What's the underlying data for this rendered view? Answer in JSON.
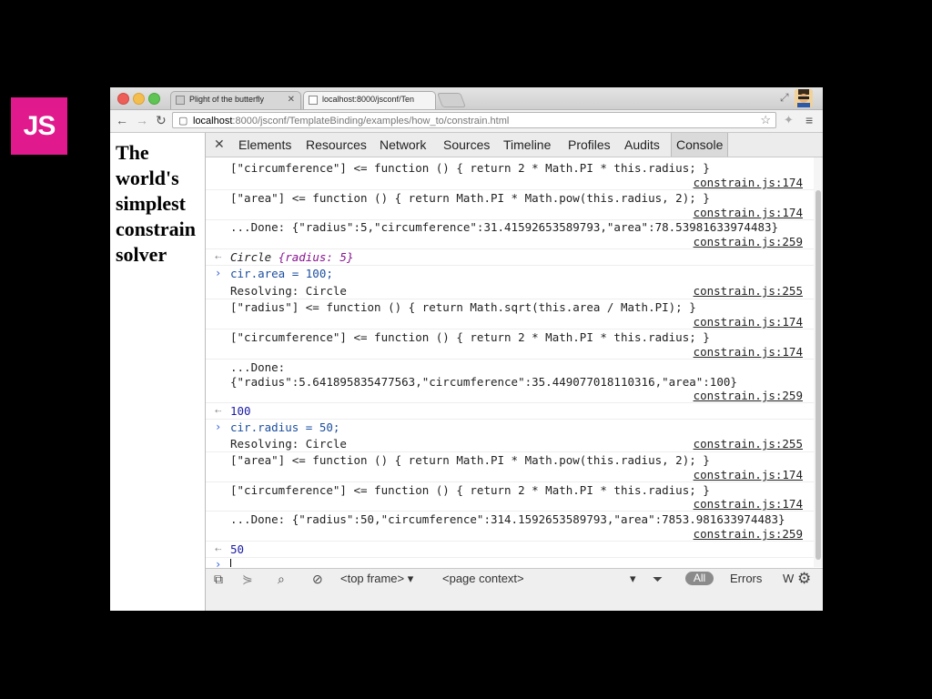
{
  "badge": "JS",
  "browser": {
    "tabs": [
      {
        "title": "Plight of the butterfly"
      },
      {
        "title": "localhost:8000/jsconf/Ten"
      }
    ],
    "url_host": "localhost",
    "url_rest": ":8000/jsconf/TemplateBinding/examples/how_to/constrain.html"
  },
  "page": {
    "title_lines": [
      "The",
      "world's",
      "simplest",
      "constrain",
      "solver"
    ]
  },
  "devtools": {
    "tabs": [
      "Elements",
      "Resources",
      "Network",
      "Sources",
      "Timeline",
      "Profiles",
      "Audits",
      "Console"
    ],
    "active_tab": "Console",
    "console": {
      "line1": "[\"circumference\"] <= function () { return 2 * Math.PI * this.radius; }",
      "src1": "constrain.js:174",
      "line2": "[\"area\"] <= function () { return Math.PI * Math.pow(this.radius, 2); }",
      "src2": "constrain.js:174",
      "line3": "...Done: {\"radius\":5,\"circumference\":31.41592653589793,\"area\":78.53981633974483}",
      "src3": "constrain.js:259",
      "ret1_name": "Circle ",
      "ret1_obj": "{radius: 5}",
      "cmd1": "cir.area = 100;",
      "line4": "Resolving: Circle",
      "src4": "constrain.js:255",
      "line5": "[\"radius\"] <= function () { return Math.sqrt(this.area / Math.PI); }",
      "src5": "constrain.js:174",
      "line6": "[\"circumference\"] <= function () { return 2 * Math.PI * this.radius; }",
      "src6": "constrain.js:174",
      "line7a": "...Done:",
      "line7b": "{\"radius\":5.641895835477563,\"circumference\":35.449077018110316,\"area\":100}",
      "src7": "constrain.js:259",
      "ret2": "100",
      "cmd2": "cir.radius = 50;",
      "line8": "Resolving: Circle",
      "src8": "constrain.js:255",
      "line9": "[\"area\"] <= function () { return Math.PI * Math.pow(this.radius, 2); }",
      "src9": "constrain.js:174",
      "line10": "[\"circumference\"] <= function () { return 2 * Math.PI * this.radius; }",
      "src10": "constrain.js:174",
      "line11": "...Done: {\"radius\":50,\"circumference\":314.1592653589793,\"area\":7853.981633974483}",
      "src11": "constrain.js:259",
      "ret3": "50"
    },
    "status": {
      "frame": "<top frame>",
      "context": "<page context>",
      "filter_all": "All",
      "errors": "Errors",
      "warnings_cut": "W"
    }
  }
}
